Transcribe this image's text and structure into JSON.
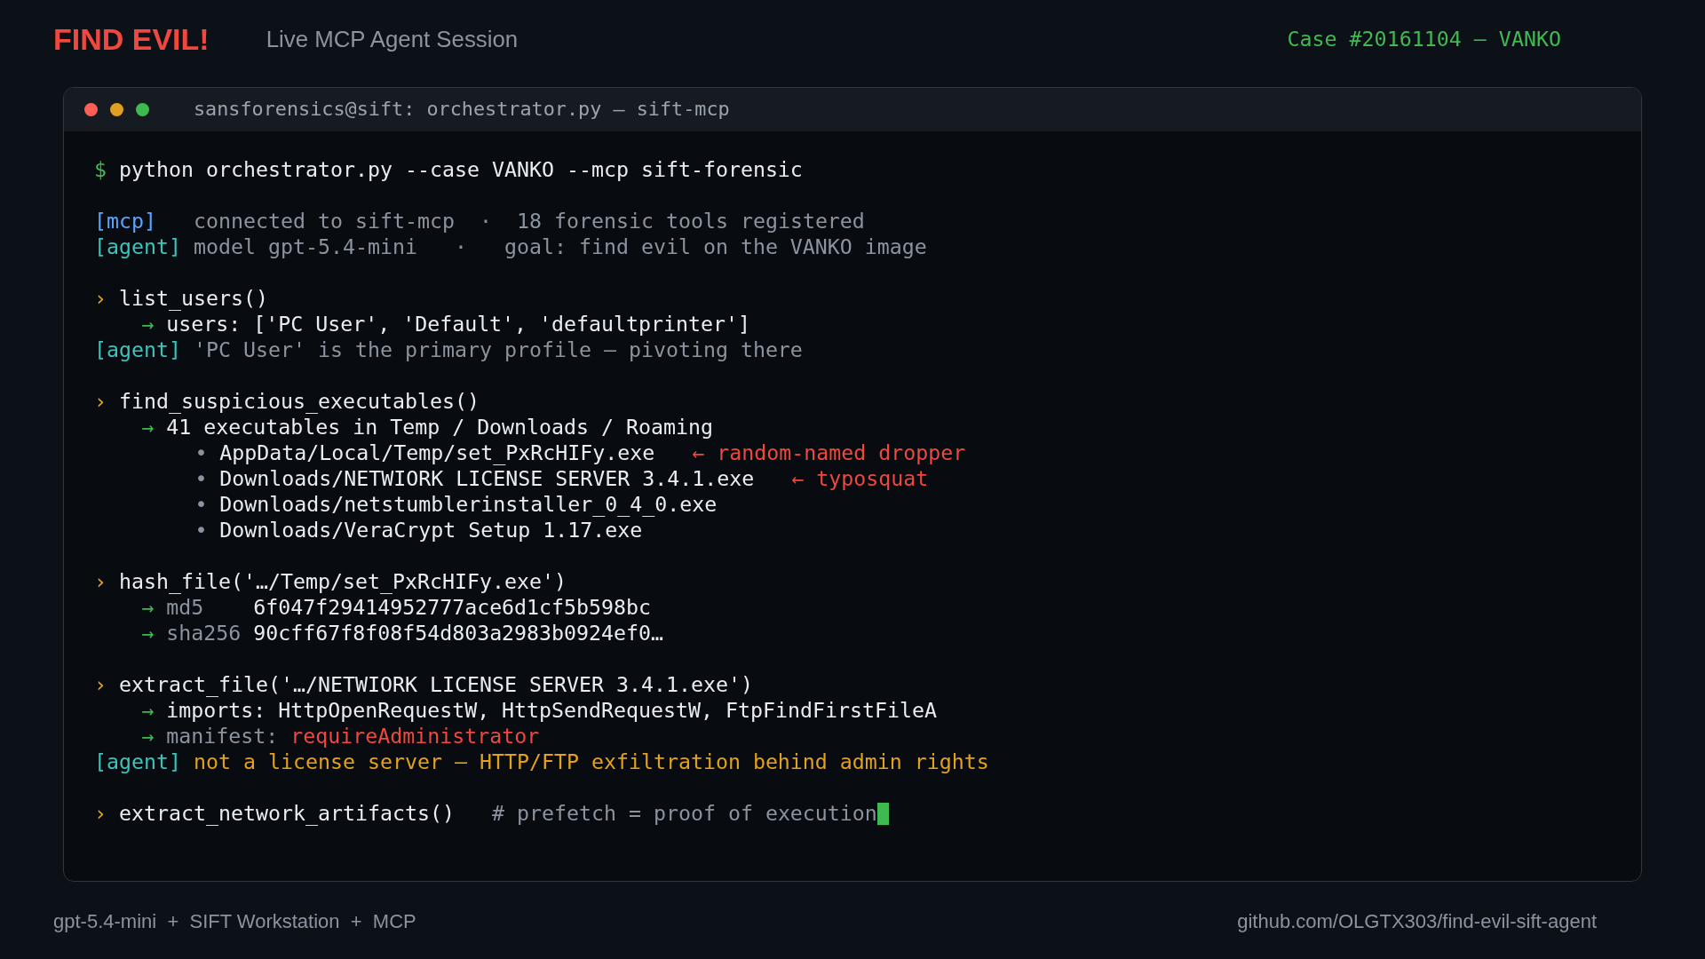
{
  "header": {
    "brand": "FIND EVIL!",
    "subtitle": "Live MCP Agent Session",
    "case": "Case #20161104 — VANKO"
  },
  "terminal": {
    "title": "sansforensics@sift: orchestrator.py — sift-mcp",
    "groups": [
      [
        {
          "segments": [
            {
              "kind": "prompt",
              "text": "$"
            },
            {
              "kind": "cmd",
              "text": " python orchestrator.py --case VANKO --mcp sift-forensic"
            }
          ]
        }
      ],
      [
        {
          "segments": [
            {
              "kind": "mcp",
              "text": "[mcp]"
            },
            {
              "kind": "dim",
              "text": "   connected to sift-mcp  ·  18 forensic tools registered"
            }
          ]
        },
        {
          "segments": [
            {
              "kind": "agent",
              "text": "[agent]"
            },
            {
              "kind": "dim",
              "text": " model gpt-5.4-mini   ·   goal: find evil on the VANKO image"
            }
          ]
        }
      ],
      [
        {
          "segments": [
            {
              "kind": "caret",
              "text": "›"
            },
            {
              "kind": "cmd",
              "text": " list_users()"
            }
          ],
          "children": [
            {
              "segments": [
                {
                  "kind": "arrow",
                  "text": "→"
                },
                {
                  "kind": "cmd",
                  "text": " users: ['PC User', 'Default', 'defaultprinter']"
                }
              ]
            }
          ]
        },
        {
          "segments": [
            {
              "kind": "agent",
              "text": "[agent]"
            },
            {
              "kind": "dim",
              "text": " 'PC User' is the primary profile — pivoting there"
            }
          ]
        }
      ],
      [
        {
          "segments": [
            {
              "kind": "caret",
              "text": "›"
            },
            {
              "kind": "cmd",
              "text": " find_suspicious_executables()"
            }
          ],
          "children": [
            {
              "segments": [
                {
                  "kind": "arrow",
                  "text": "→"
                },
                {
                  "kind": "cmd",
                  "text": " 41 executables in Temp / Downloads / Roaming"
                }
              ],
              "children": [
                {
                  "segments": [
                    {
                      "kind": "bullet",
                      "text": "•"
                    },
                    {
                      "kind": "cmd",
                      "text": " AppData/Local/Temp/set_PxRcHIFy.exe"
                    },
                    {
                      "kind": "alert",
                      "text": "   ← random-named dropper"
                    }
                  ]
                },
                {
                  "segments": [
                    {
                      "kind": "bullet",
                      "text": "•"
                    },
                    {
                      "kind": "cmd",
                      "text": " Downloads/NETWIORK LICENSE SERVER 3.4.1.exe"
                    },
                    {
                      "kind": "alert",
                      "text": "   ← typosquat"
                    }
                  ]
                },
                {
                  "segments": [
                    {
                      "kind": "bullet",
                      "text": "•"
                    },
                    {
                      "kind": "cmd",
                      "text": " Downloads/netstumblerinstaller_0_4_0.exe"
                    }
                  ]
                },
                {
                  "segments": [
                    {
                      "kind": "bullet",
                      "text": "•"
                    },
                    {
                      "kind": "cmd",
                      "text": " Downloads/VeraCrypt Setup 1.17.exe"
                    }
                  ]
                }
              ]
            }
          ]
        }
      ],
      [
        {
          "segments": [
            {
              "kind": "caret",
              "text": "›"
            },
            {
              "kind": "cmd",
              "text": " hash_file('…/Temp/set_PxRcHIFy.exe')"
            }
          ],
          "children": [
            {
              "segments": [
                {
                  "kind": "arrow",
                  "text": "→"
                },
                {
                  "kind": "dim",
                  "text": " md5   "
                },
                {
                  "kind": "cmd",
                  "text": " 6f047f29414952777ace6d1cf5b598bc"
                }
              ]
            },
            {
              "segments": [
                {
                  "kind": "arrow",
                  "text": "→"
                },
                {
                  "kind": "dim",
                  "text": " sha256"
                },
                {
                  "kind": "cmd",
                  "text": " 90cff67f8f08f54d803a2983b0924ef0…"
                }
              ]
            }
          ]
        }
      ],
      [
        {
          "segments": [
            {
              "kind": "caret",
              "text": "›"
            },
            {
              "kind": "cmd",
              "text": " extract_file('…/NETWIORK LICENSE SERVER 3.4.1.exe')"
            }
          ],
          "children": [
            {
              "segments": [
                {
                  "kind": "arrow",
                  "text": "→"
                },
                {
                  "kind": "cmd",
                  "text": " imports: HttpOpenRequestW, HttpSendRequestW, FtpFindFirstFileA"
                }
              ]
            },
            {
              "segments": [
                {
                  "kind": "arrow",
                  "text": "→"
                },
                {
                  "kind": "dim",
                  "text": " manifest: "
                },
                {
                  "kind": "alert",
                  "text": "requireAdministrator"
                }
              ]
            }
          ]
        },
        {
          "segments": [
            {
              "kind": "agent",
              "text": "[agent]"
            },
            {
              "kind": "warn",
              "text": " not a license server — HTTP/FTP exfiltration behind admin rights"
            }
          ]
        }
      ],
      [
        {
          "segments": [
            {
              "kind": "caret",
              "text": "›"
            },
            {
              "kind": "cmd",
              "text": " extract_network_artifacts()"
            },
            {
              "kind": "dim",
              "text": "   # prefetch = proof of execution"
            }
          ],
          "cursor": true
        }
      ]
    ]
  },
  "footer": {
    "left": "gpt-5.4-mini  +  SIFT Workstation  +  MCP",
    "right": "github.com/OLGTX303/find-evil-sift-agent"
  }
}
